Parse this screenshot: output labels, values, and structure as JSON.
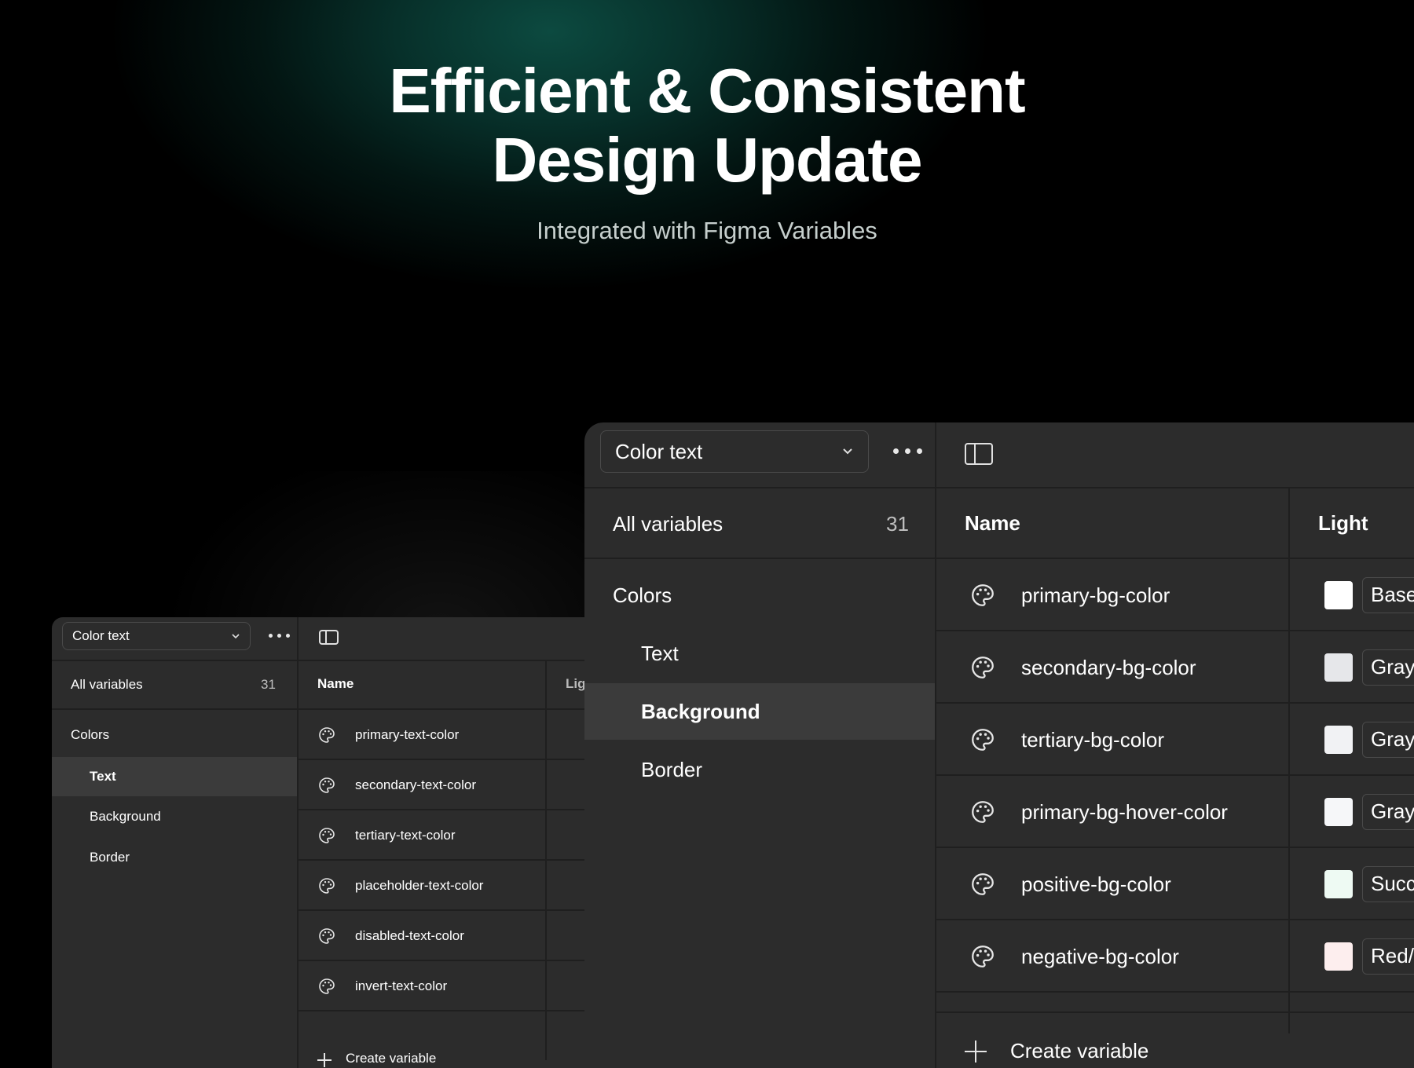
{
  "hero": {
    "title_line1": "Efficient & Consistent",
    "title_line2": "Design Update",
    "subtitle": "Integrated with Figma Variables"
  },
  "back_panel": {
    "collection_dropdown": "Color text",
    "all_variables_label": "All variables",
    "all_variables_count": "31",
    "groups": {
      "colors": "Colors",
      "text": "Text",
      "background": "Background",
      "border": "Border"
    },
    "selected_group": "Text",
    "name_header": "Name",
    "mode_header": "Lig",
    "variables": [
      {
        "name": "primary-text-color",
        "swatch": "#1c2230"
      },
      {
        "name": "secondary-text-color",
        "swatch": "#474c55"
      },
      {
        "name": "tertiary-text-color",
        "swatch": "#5f636b"
      },
      {
        "name": "placeholder-text-color",
        "swatch": "#7b7e85"
      },
      {
        "name": "disabled-text-color",
        "swatch": "#a2a3a7"
      },
      {
        "name": "invert-text-color",
        "swatch": "#c9c9cb"
      }
    ],
    "create_variable": "Create variable"
  },
  "front_panel": {
    "collection_dropdown": "Color text",
    "all_variables_label": "All variables",
    "all_variables_count": "31",
    "groups": {
      "colors": "Colors",
      "text": "Text",
      "background": "Background",
      "border": "Border"
    },
    "selected_group": "Background",
    "name_header": "Name",
    "mode_header": "Light",
    "variables": [
      {
        "name": "primary-bg-color",
        "swatch": "#ffffff",
        "value": "Base"
      },
      {
        "name": "secondary-bg-color",
        "swatch": "#e6e7ea",
        "value": "Gray"
      },
      {
        "name": "tertiary-bg-color",
        "swatch": "#f1f2f4",
        "value": "Gray"
      },
      {
        "name": "primary-bg-hover-color",
        "swatch": "#f6f7f9",
        "value": "Gray"
      },
      {
        "name": "positive-bg-color",
        "swatch": "#eefaf3",
        "value": "Succ"
      },
      {
        "name": "negative-bg-color",
        "swatch": "#fdeeee",
        "value": "Red/"
      }
    ],
    "create_variable": "Create variable"
  },
  "colors": {
    "panel_bg": "#2c2c2c",
    "selected_row": "#3b3b3b",
    "divider": "#1f1f1f",
    "accent_glow": "#0c4a40"
  }
}
